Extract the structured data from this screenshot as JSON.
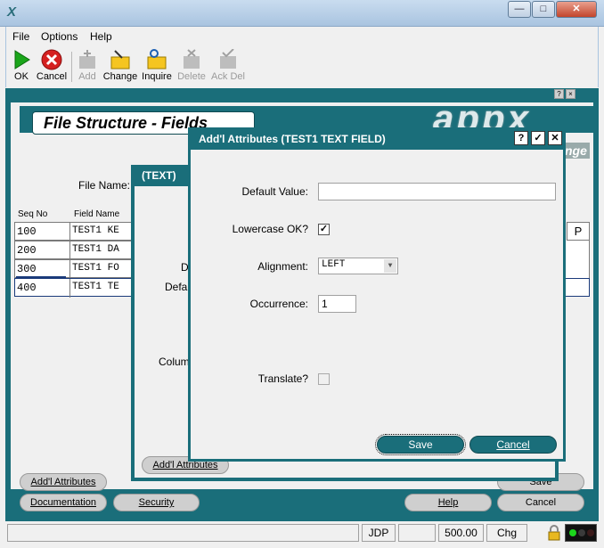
{
  "window": {
    "minimize": "—",
    "maximize": "□",
    "close": "✕"
  },
  "menu": [
    "File",
    "Options",
    "Help"
  ],
  "toolbar": {
    "ok": "OK",
    "cancel": "Cancel",
    "add": "Add",
    "change": "Change",
    "inquire": "Inquire",
    "delete": "Delete",
    "ack_del": "Ack Del"
  },
  "main": {
    "title": "File Structure - Fields",
    "logo": "appx",
    "file_name_label": "File Name:",
    "col_seq": "Seq No",
    "col_field": "Field Name",
    "rows": [
      {
        "seq": "100",
        "field": "TEST1 KE"
      },
      {
        "seq": "200",
        "field": "TEST1 DA"
      },
      {
        "seq": "300",
        "field": "TEST1 FO"
      },
      {
        "seq": "400",
        "field": "TEST1 TE"
      }
    ],
    "col_p": "P",
    "change_partial": "nge",
    "buttons": {
      "addl_attributes": "Add'l Attributes",
      "documentation": "Documentation",
      "security": "Security",
      "help": "Help",
      "cancel": "Cancel",
      "save": "Save"
    }
  },
  "mid_dialog": {
    "title": "(TEXT)",
    "label_d": "D",
    "label_defa": "Defa",
    "label_colum": "Colum",
    "addl_button": "Add'l Attributes"
  },
  "dialog": {
    "title": "Add'l Attributes  (TEST1 TEXT FIELD)",
    "help": "?",
    "ok": "✓",
    "close": "✕",
    "default_value_label": "Default Value:",
    "default_value": "",
    "lowercase_label": "Lowercase OK?",
    "lowercase_checked": "✓",
    "alignment_label": "Alignment:",
    "alignment_value": "LEFT",
    "occurrence_label": "Occurrence:",
    "occurrence_value": "1",
    "translate_label": "Translate?",
    "save": "Save",
    "cancel": "Cancel"
  },
  "status": {
    "user": "JDP",
    "amount": "500.00",
    "mode": "Chg"
  }
}
